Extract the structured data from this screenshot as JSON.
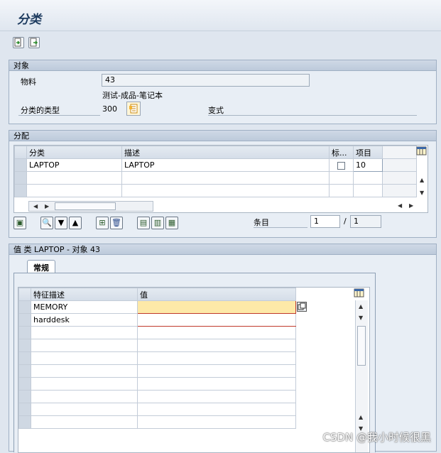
{
  "window": {
    "title": "分类"
  },
  "object_panel": {
    "header": "对象",
    "material_label": "物料",
    "material_value": "43",
    "material_desc": "测试-成品-笔记本",
    "class_type_label": "分类的类型",
    "class_type_value": "300",
    "variant_label": "变式"
  },
  "assign_panel": {
    "header": "分配",
    "columns": [
      "分类",
      "描述",
      "标...",
      "项目"
    ],
    "rows": [
      {
        "class": "LAPTOP",
        "desc": "LAPTOP",
        "std": false,
        "item": "10"
      }
    ],
    "entry_label": "条目",
    "entry_current": "1",
    "entry_sep": "/",
    "entry_total": "1"
  },
  "values_panel": {
    "header": "值 类 LAPTOP - 对象 43",
    "tab": "常规",
    "columns": [
      "特征描述",
      "值"
    ],
    "rows": [
      {
        "char": "MEMORY",
        "value": ""
      },
      {
        "char": "harddesk",
        "value": ""
      }
    ]
  },
  "watermark": "CSDN @我小时候很黑",
  "icons": [
    "display-icon",
    "change-icon",
    "possible-entries-icon",
    "table-settings-icon",
    "scroll-up-icon",
    "scroll-down-icon"
  ]
}
